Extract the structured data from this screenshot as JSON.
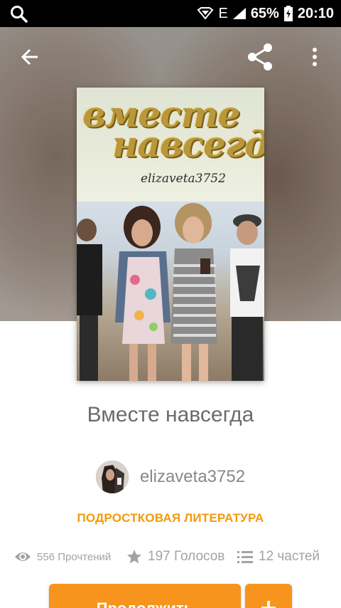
{
  "status_bar": {
    "network_type": "E",
    "battery_percent": "65%",
    "time": "20:10",
    "icons": [
      "search-icon",
      "signal-diamond-icon",
      "signal-bars-icon",
      "battery-charging-icon"
    ]
  },
  "toolbar": {
    "icons": [
      "back-arrow-icon",
      "share-icon",
      "more-vertical-icon"
    ]
  },
  "cover": {
    "title_line1": "вместе",
    "title_line2": "навсегда",
    "author": "elizaveta3752"
  },
  "story": {
    "title": "Вместе навсегда",
    "author": "elizaveta3752",
    "category": "ПОДРОСТКОВАЯ ЛИТЕРАТУРА",
    "reads": "556 Прочтений",
    "votes": "197 Голосов",
    "parts": "12 частей"
  },
  "actions": {
    "continue_label": "Продолжить"
  },
  "colors": {
    "accent": "#f7941d",
    "category": "#f39a0b",
    "muted_text": "#a3a3a3"
  }
}
